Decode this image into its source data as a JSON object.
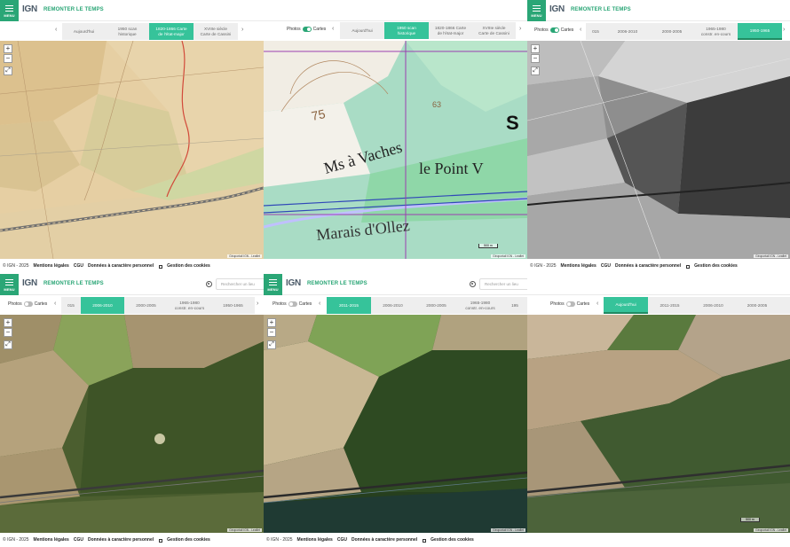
{
  "app": {
    "menu_label": "MENU",
    "logo_text": "IGN",
    "title": "REMONTER LE TEMPS",
    "search_placeholder": "Rechercher un lieu",
    "toggle_photos": "Photos",
    "toggle_maps": "Cartes"
  },
  "colors": {
    "accent": "#2aa676",
    "active_slot": "#36c39a",
    "timeline_bg": "#eeeeee"
  },
  "footer": {
    "copyright": "© IGN - 2025",
    "legal": "Mentions légales",
    "cgu": "CGU",
    "personal_data": "Données à caractère personnel",
    "cookies": "Gestion des cookies"
  },
  "panels": [
    {
      "id": "panel-1",
      "layer": "Carte de l'état-major",
      "slots": [
        {
          "line1": "Aujourd'hui",
          "line2": ""
        },
        {
          "line1": "1950 scan",
          "line2": "historique"
        },
        {
          "line1": "1820-1866 Carte",
          "line2": "de l'état-major",
          "active": true
        },
        {
          "line1": "XVIIIe siècle",
          "line2": "Carte de Cassini"
        }
      ],
      "attribution": "Géoportail IGN - Leaflet"
    },
    {
      "id": "panel-2",
      "layer": "1950 scan historique",
      "map_labels": {
        "elev_75": "75",
        "elev_63": "63",
        "place_1": "Ms à Vaches",
        "place_2": "le Point V",
        "place_3": "Marais d'Ollez",
        "letter_s": "S"
      },
      "slots": [
        {
          "line1": "Aujourd'hui",
          "line2": ""
        },
        {
          "line1": "1950 scan",
          "line2": "historique",
          "active": true
        },
        {
          "line1": "1820-1866 Carte",
          "line2": "de l'état-major"
        },
        {
          "line1": "XVIIIe siècle",
          "line2": "Carte de Cassini"
        }
      ],
      "scale": "500 m",
      "attribution": "Géoportail IGN - Leaflet"
    },
    {
      "id": "panel-3",
      "layer": "1950-1965",
      "slots": [
        {
          "line1": "015",
          "line2": ""
        },
        {
          "line1": "2006-2010",
          "line2": ""
        },
        {
          "line1": "2000-2005",
          "line2": ""
        },
        {
          "line1": "1965-1980",
          "line2": "constr. en-cours"
        },
        {
          "line1": "1950-1965",
          "line2": "",
          "active": true
        }
      ],
      "attribution": "Géoportail IGN - Leaflet"
    },
    {
      "id": "panel-4",
      "layer": "2006-2010",
      "slots": [
        {
          "line1": "015",
          "line2": ""
        },
        {
          "line1": "2006-2010",
          "line2": "",
          "active": true
        },
        {
          "line1": "2000-2005",
          "line2": ""
        },
        {
          "line1": "1965-1980",
          "line2": "constr. en-cours"
        },
        {
          "line1": "1950-1965",
          "line2": ""
        }
      ],
      "attribution": "Géoportail IGN - Leaflet"
    },
    {
      "id": "panel-5",
      "layer": "2011-2015",
      "slots": [
        {
          "line1": "2011-2015",
          "line2": "",
          "active": true
        },
        {
          "line1": "2006-2010",
          "line2": ""
        },
        {
          "line1": "2000-2005",
          "line2": ""
        },
        {
          "line1": "1965-1980",
          "line2": "constr. en-cours"
        },
        {
          "line1": "195",
          "line2": ""
        }
      ],
      "attribution": "Géoportail IGN - Leaflet"
    },
    {
      "id": "panel-6",
      "layer": "Aujourd'hui",
      "slots": [
        {
          "line1": "Aujourd'hui",
          "line2": "",
          "active": true
        },
        {
          "line1": "2011-2015",
          "line2": ""
        },
        {
          "line1": "2006-2010",
          "line2": ""
        },
        {
          "line1": "2000-2005",
          "line2": ""
        },
        {
          "line1": "",
          "line2": ""
        }
      ],
      "scale": "500 m",
      "attribution": "Géoportail IGN - Leaflet"
    }
  ]
}
